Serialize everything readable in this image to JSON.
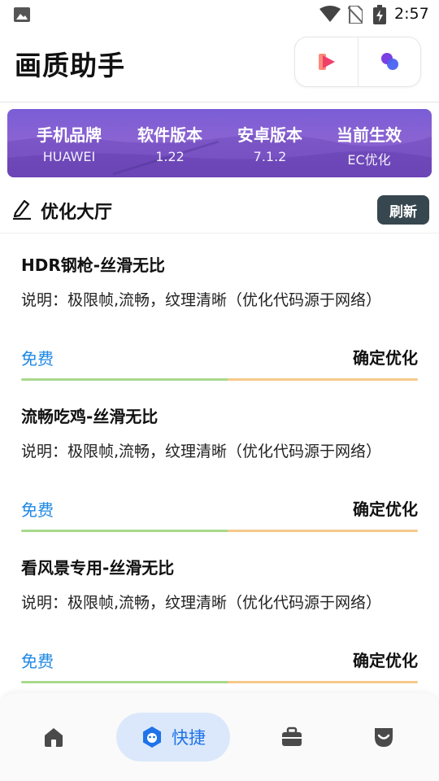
{
  "status_bar": {
    "time": "2:57"
  },
  "header": {
    "title": "画质助手"
  },
  "banner": {
    "items": [
      {
        "label": "手机品牌",
        "value": "HUAWEI"
      },
      {
        "label": "软件版本",
        "value": "1.22"
      },
      {
        "label": "安卓版本",
        "value": "7.1.2"
      },
      {
        "label": "当前生效",
        "value": "EC优化"
      }
    ]
  },
  "section": {
    "title": "优化大厅",
    "refresh_label": "刷新"
  },
  "cards": [
    {
      "title": "HDR钢枪-丝滑无比",
      "description": "说明：极限帧,流畅，纹理清晰（优化代码源于网络）",
      "price": "免费",
      "action": "确定优化"
    },
    {
      "title": "流畅吃鸡-丝滑无比",
      "description": "说明：极限帧,流畅，纹理清晰（优化代码源于网络）",
      "price": "免费",
      "action": "确定优化"
    },
    {
      "title": "看风景专用-丝滑无比",
      "description": "说明：极限帧,流畅，纹理清晰（优化代码源于网络）",
      "price": "免费",
      "action": "确定优化"
    }
  ],
  "bottom_nav": {
    "items": [
      {
        "icon": "home-icon"
      },
      {
        "icon": "quick-icon",
        "label": "快捷",
        "active": true
      },
      {
        "icon": "briefcase-icon"
      },
      {
        "icon": "shield-icon"
      }
    ]
  },
  "colors": {
    "banner": "#8a63d2",
    "price": "#1e88e5",
    "refresh_button": "#37474f",
    "nav_active_bg": "#dbe8fb",
    "nav_active": "#1e73e8",
    "bar_green": "#a8d98c",
    "bar_orange": "#f6c98a"
  }
}
